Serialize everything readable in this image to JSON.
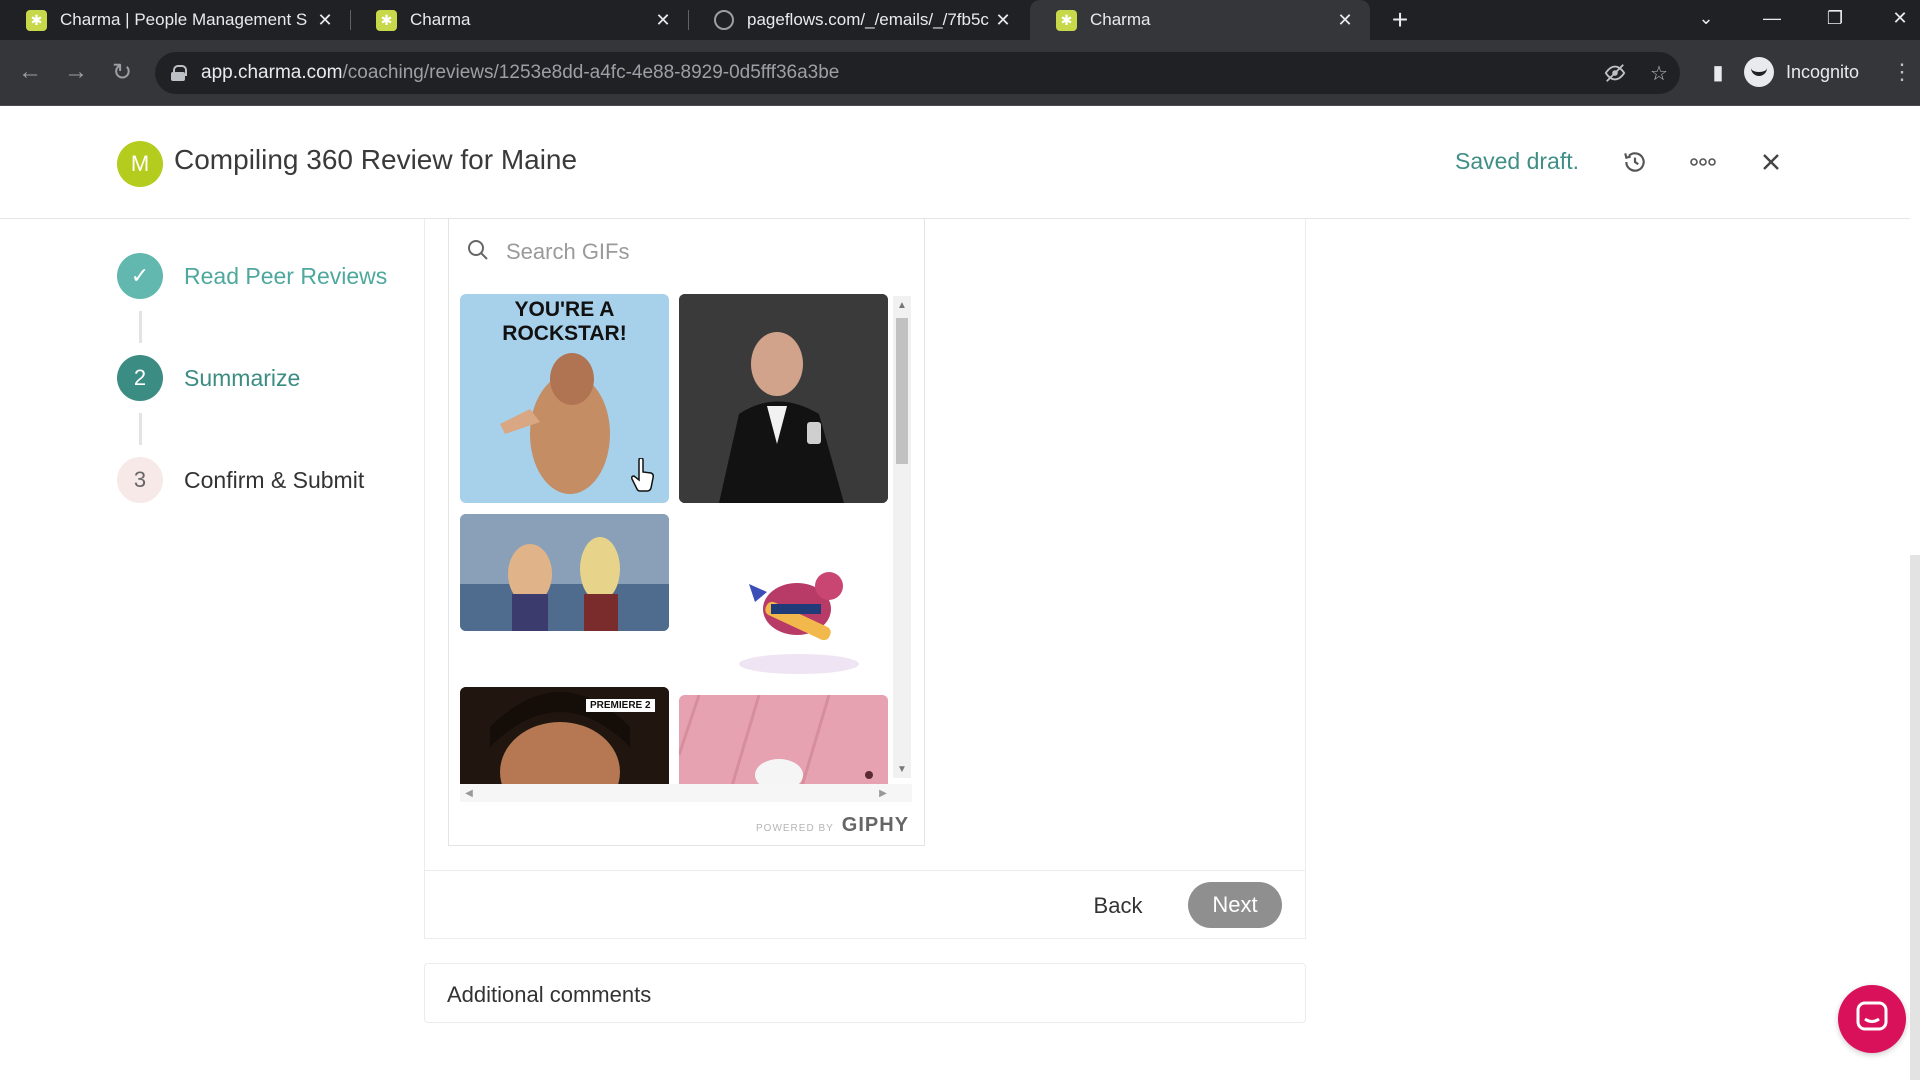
{
  "browser": {
    "tabs": [
      {
        "title": "Charma | People Management S",
        "icon": "charma-favicon",
        "active": false
      },
      {
        "title": "Charma",
        "icon": "charma-favicon",
        "active": false
      },
      {
        "title": "pageflows.com/_/emails/_/7fb5c",
        "icon": "globe-icon",
        "active": false
      },
      {
        "title": "Charma",
        "icon": "charma-favicon",
        "active": true
      }
    ],
    "url_host": "app.charma.com",
    "url_path": "/coaching/reviews/1253e8dd-a4fc-4e88-8929-0d5fff36a3be",
    "profile_label": "Incognito"
  },
  "header": {
    "avatar_initial": "M",
    "title": "Compiling 360 Review for Maine",
    "status": "Saved draft."
  },
  "steps": [
    {
      "marker": "✓",
      "label": "Read Peer Reviews",
      "state": "done"
    },
    {
      "marker": "2",
      "label": "Summarize",
      "state": "current"
    },
    {
      "marker": "3",
      "label": "Confirm & Submit",
      "state": "todo"
    }
  ],
  "gif_picker": {
    "search_placeholder": "Search GIFs",
    "gifs": [
      {
        "caption": "YOU'RE A ROCKSTAR!",
        "subject": "woman pointing"
      },
      {
        "caption": "",
        "subject": "man in tuxedo with glass"
      },
      {
        "caption": "",
        "subject": "cartoon duo on couch"
      },
      {
        "caption": "",
        "subject": "cartoon bird with guitar"
      },
      {
        "caption": "PREMIERE 2",
        "subject": "man close-up"
      },
      {
        "caption": "",
        "subject": "cartoon on pink background"
      }
    ],
    "powered_by": "POWERED BY",
    "brand": "GIPHY"
  },
  "actions": {
    "back_label": "Back",
    "next_label": "Next"
  },
  "comments": {
    "label": "Additional comments"
  },
  "colors": {
    "accent": "#3b8c82",
    "accent_light": "#62b8ae",
    "avatar": "#b4cc1d",
    "chat": "#d9115a"
  }
}
